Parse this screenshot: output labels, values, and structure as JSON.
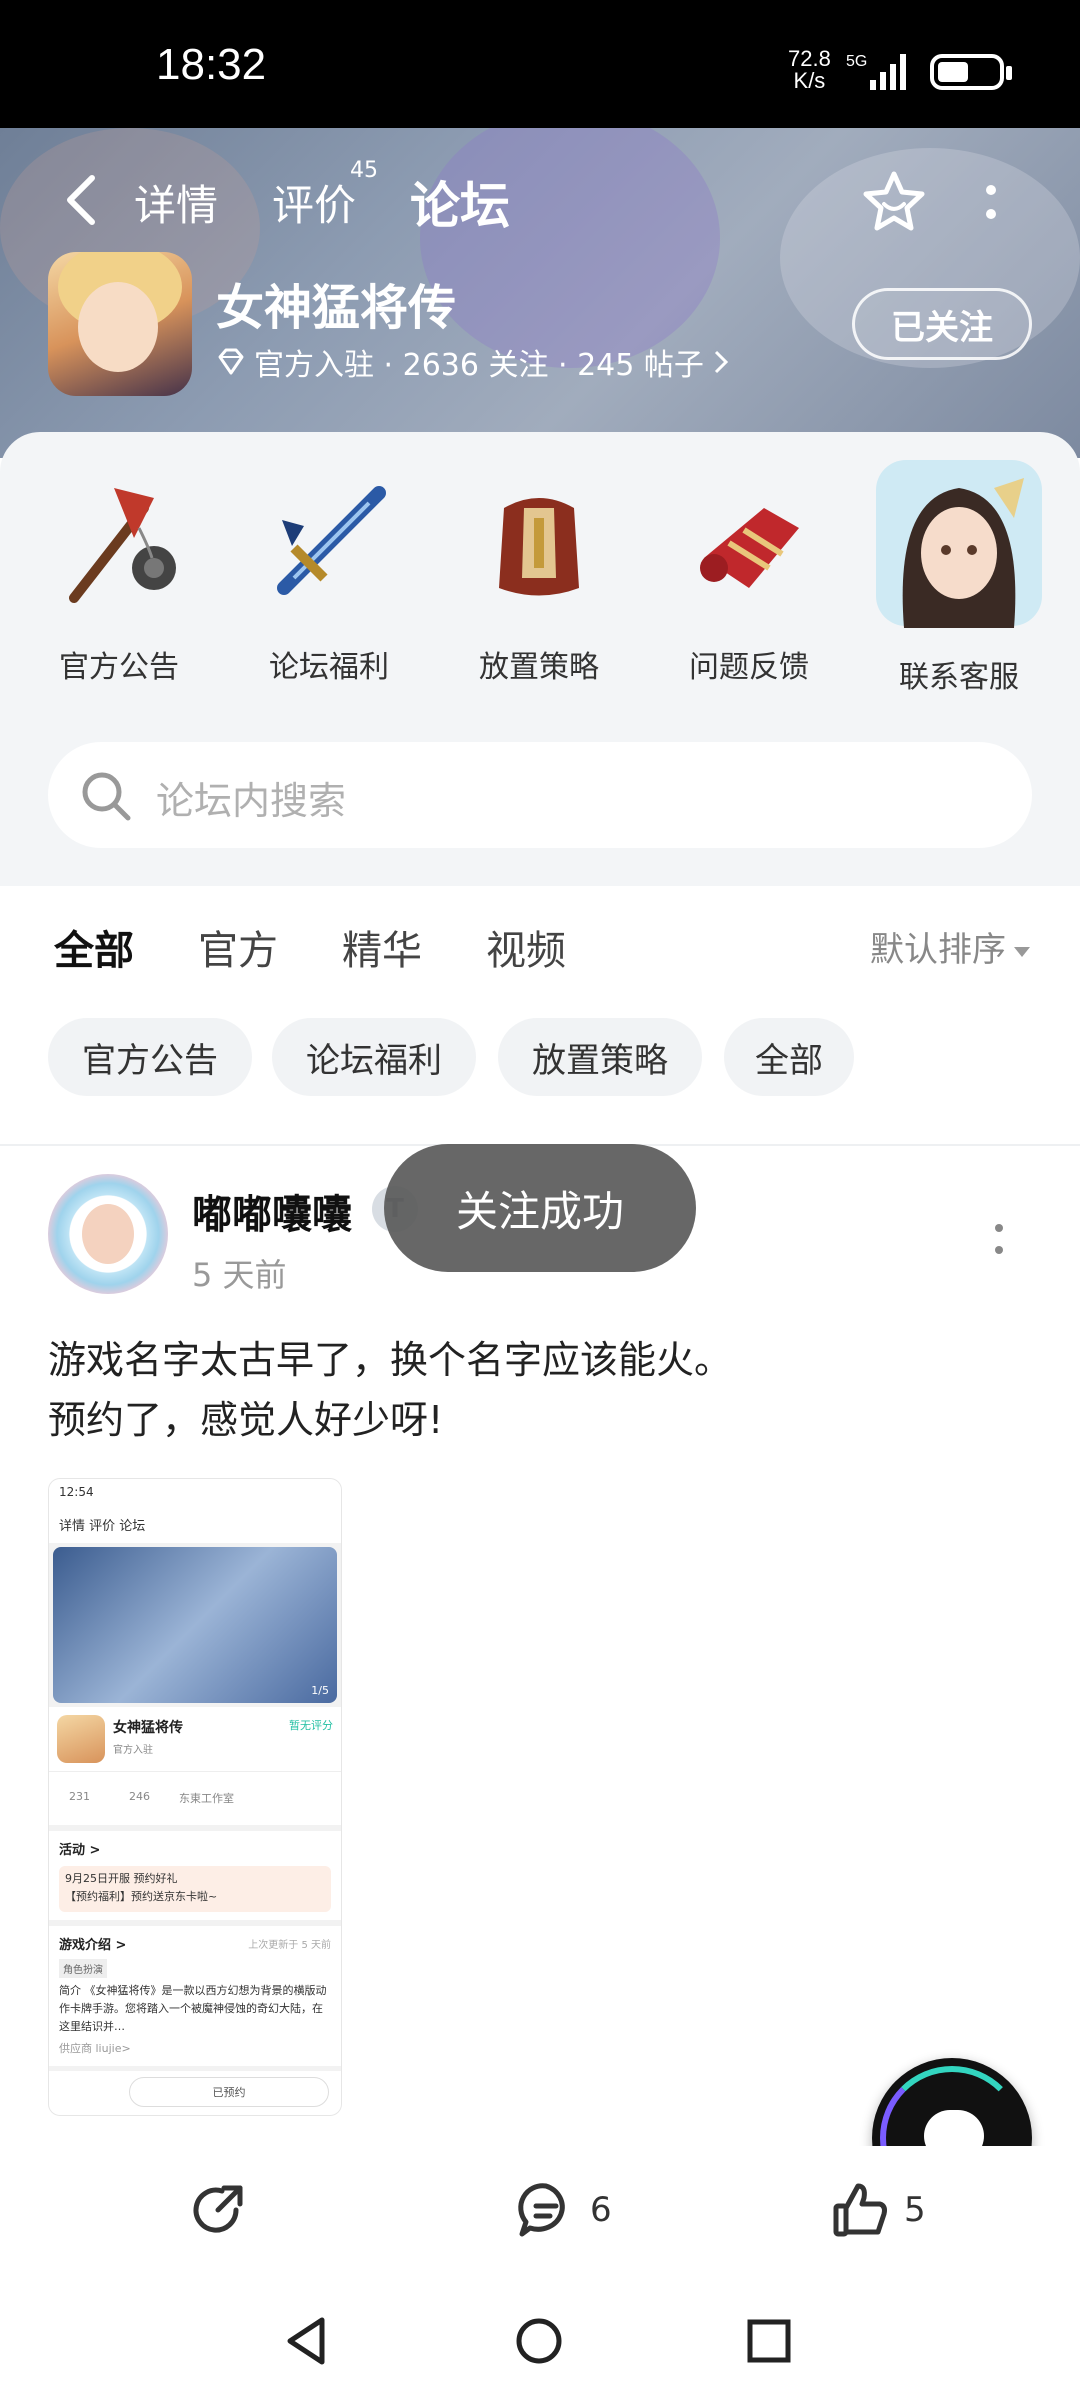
{
  "status_bar": {
    "time": "18:32",
    "net_speed_top": "72.8",
    "net_speed_bottom": "K/s",
    "network": "5G"
  },
  "top_nav": {
    "tabs": [
      {
        "label": "详情"
      },
      {
        "label": "评价"
      },
      {
        "label": "论坛"
      }
    ],
    "review_count": "45",
    "active_tab": "论坛"
  },
  "game": {
    "title": "女神猛将传",
    "meta": "官方入驻 · 2636 关注 · 245 帖子",
    "follow_label": "已关注"
  },
  "categories": [
    {
      "label": "官方公告",
      "icon": "mace-icon"
    },
    {
      "label": "论坛福利",
      "icon": "sword-icon"
    },
    {
      "label": "放置策略",
      "icon": "armor-icon"
    },
    {
      "label": "问题反馈",
      "icon": "gauntlet-icon"
    },
    {
      "label": "联系客服",
      "icon": "character-avatar-icon"
    }
  ],
  "search": {
    "placeholder": "论坛内搜索"
  },
  "filter_tabs": [
    {
      "label": "全部"
    },
    {
      "label": "官方"
    },
    {
      "label": "精华"
    },
    {
      "label": "视频"
    }
  ],
  "sort_label": "默认排序",
  "chips": [
    {
      "label": "官方公告"
    },
    {
      "label": "论坛福利"
    },
    {
      "label": "放置策略"
    },
    {
      "label": "全部"
    }
  ],
  "toast": "关注成功",
  "post": {
    "username": "嘟嘟囔囔",
    "level_badge": "T",
    "time": "5 天前",
    "text_line1": "游戏名字太古早了，换个名字应该能火。",
    "text_line2": "预约了，感觉人好少呀!",
    "screenshot": {
      "time": "12:54",
      "tabs": "详情  评价  论坛",
      "page": "1/5",
      "game_title": "女神猛将传",
      "official": "官方入驻",
      "no_rating": "暂无评分",
      "stat1": "231",
      "stat2": "246",
      "stat3": "东東工作室",
      "activity": "活动 >",
      "promo1": "9月25日开服  预约好礼",
      "promo2": "【预约福利】预约送京东卡啦~",
      "intro": "游戏介绍 >",
      "updated": "上次更新于 5 天前",
      "tag": "角色扮演",
      "intro_text": "简介 《女神猛将传》是一款以西方幻想为背景的横版动作卡牌手游。您将踏入一个被魔神侵蚀的奇幻大陆，在这里结识并…",
      "provider": "供应商 liujie>",
      "reserved": "已预约"
    }
  },
  "actions": {
    "share": "",
    "comments": "6",
    "likes": "5"
  },
  "colors": {
    "accent": "#25d6b8",
    "toast_bg": "#5a5a5a"
  }
}
